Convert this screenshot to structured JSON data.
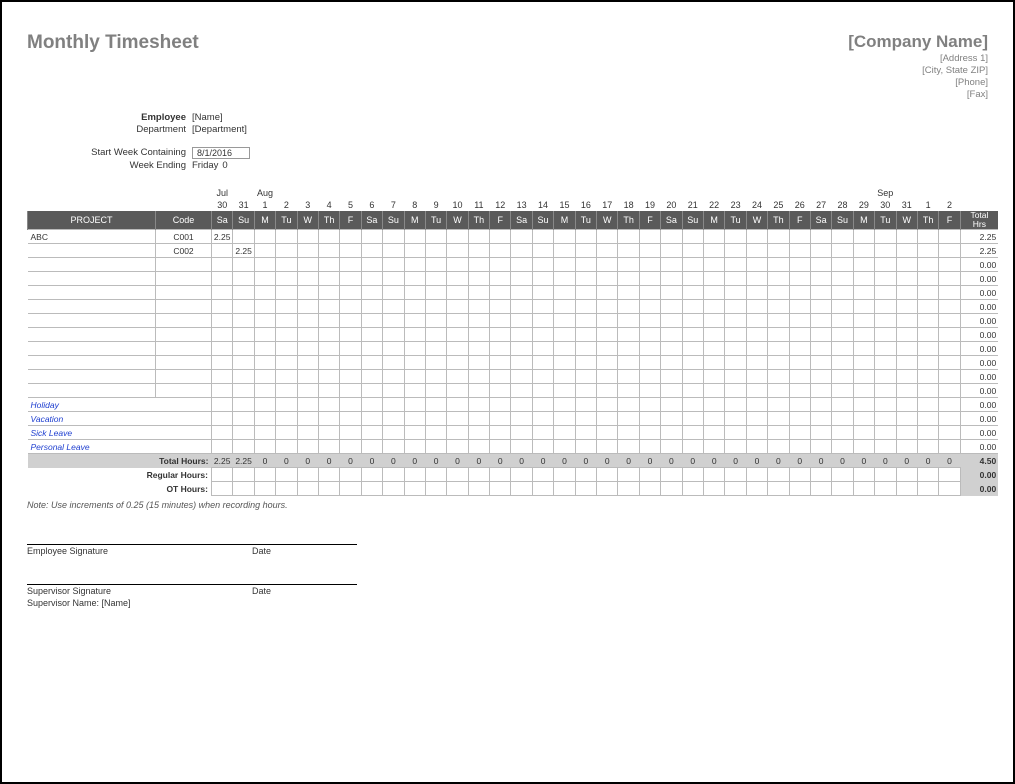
{
  "title": "Monthly Timesheet",
  "company": {
    "name": "[Company Name]",
    "address1": "[Address 1]",
    "cityzip": "[City, State ZIP]",
    "phone": "[Phone]",
    "fax": "[Fax]"
  },
  "info": {
    "employee_label": "Employee",
    "employee_value": "[Name]",
    "department_label": "Department",
    "department_value": "[Department]",
    "startweek_label": "Start Week Containing",
    "startweek_value": "8/1/2016",
    "weekending_label": "Week Ending",
    "weekending_value": "Friday",
    "weekending_after": "0"
  },
  "months": [
    "",
    "",
    "Jul",
    "",
    "Aug",
    "",
    "",
    "",
    "",
    "",
    "",
    "",
    "",
    "",
    "",
    "",
    "",
    "",
    "",
    "",
    "",
    "",
    "",
    "",
    "",
    "",
    "",
    "",
    "",
    "",
    "",
    "",
    "",
    "Sep",
    "",
    ""
  ],
  "dates": [
    "",
    "",
    "30",
    "31",
    "1",
    "2",
    "3",
    "4",
    "5",
    "6",
    "7",
    "8",
    "9",
    "10",
    "11",
    "12",
    "13",
    "14",
    "15",
    "16",
    "17",
    "18",
    "19",
    "20",
    "21",
    "22",
    "23",
    "24",
    "25",
    "26",
    "27",
    "28",
    "29",
    "30",
    "31",
    "1",
    "2",
    ""
  ],
  "dow_header": {
    "project": "PROJECT",
    "code": "Code",
    "total": "Total\nHrs"
  },
  "dow": [
    "Sa",
    "Su",
    "M",
    "Tu",
    "W",
    "Th",
    "F",
    "Sa",
    "Su",
    "M",
    "Tu",
    "W",
    "Th",
    "F",
    "Sa",
    "Su",
    "M",
    "Tu",
    "W",
    "Th",
    "F",
    "Sa",
    "Su",
    "M",
    "Tu",
    "W",
    "Th",
    "F",
    "Sa",
    "Su",
    "M",
    "Tu",
    "W",
    "Th",
    "F"
  ],
  "rows": [
    {
      "project": "ABC",
      "code": "C001",
      "cells": [
        "2.25",
        "",
        "",
        "",
        "",
        "",
        "",
        "",
        "",
        "",
        "",
        "",
        "",
        "",
        "",
        "",
        "",
        "",
        "",
        "",
        "",
        "",
        "",
        "",
        "",
        "",
        "",
        "",
        "",
        "",
        "",
        "",
        "",
        "",
        ""
      ],
      "total": "2.25"
    },
    {
      "project": "",
      "code": "C002",
      "cells": [
        "",
        "2.25",
        "",
        "",
        "",
        "",
        "",
        "",
        "",
        "",
        "",
        "",
        "",
        "",
        "",
        "",
        "",
        "",
        "",
        "",
        "",
        "",
        "",
        "",
        "",
        "",
        "",
        "",
        "",
        "",
        "",
        "",
        "",
        "",
        ""
      ],
      "total": "2.25"
    },
    {
      "project": "",
      "code": "",
      "cells": [
        "",
        "",
        "",
        "",
        "",
        "",
        "",
        "",
        "",
        "",
        "",
        "",
        "",
        "",
        "",
        "",
        "",
        "",
        "",
        "",
        "",
        "",
        "",
        "",
        "",
        "",
        "",
        "",
        "",
        "",
        "",
        "",
        "",
        "",
        ""
      ],
      "total": "0.00"
    },
    {
      "project": "",
      "code": "",
      "cells": [
        "",
        "",
        "",
        "",
        "",
        "",
        "",
        "",
        "",
        "",
        "",
        "",
        "",
        "",
        "",
        "",
        "",
        "",
        "",
        "",
        "",
        "",
        "",
        "",
        "",
        "",
        "",
        "",
        "",
        "",
        "",
        "",
        "",
        "",
        ""
      ],
      "total": "0.00"
    },
    {
      "project": "",
      "code": "",
      "cells": [
        "",
        "",
        "",
        "",
        "",
        "",
        "",
        "",
        "",
        "",
        "",
        "",
        "",
        "",
        "",
        "",
        "",
        "",
        "",
        "",
        "",
        "",
        "",
        "",
        "",
        "",
        "",
        "",
        "",
        "",
        "",
        "",
        "",
        "",
        ""
      ],
      "total": "0.00"
    },
    {
      "project": "",
      "code": "",
      "cells": [
        "",
        "",
        "",
        "",
        "",
        "",
        "",
        "",
        "",
        "",
        "",
        "",
        "",
        "",
        "",
        "",
        "",
        "",
        "",
        "",
        "",
        "",
        "",
        "",
        "",
        "",
        "",
        "",
        "",
        "",
        "",
        "",
        "",
        "",
        ""
      ],
      "total": "0.00"
    },
    {
      "project": "",
      "code": "",
      "cells": [
        "",
        "",
        "",
        "",
        "",
        "",
        "",
        "",
        "",
        "",
        "",
        "",
        "",
        "",
        "",
        "",
        "",
        "",
        "",
        "",
        "",
        "",
        "",
        "",
        "",
        "",
        "",
        "",
        "",
        "",
        "",
        "",
        "",
        "",
        ""
      ],
      "total": "0.00"
    },
    {
      "project": "",
      "code": "",
      "cells": [
        "",
        "",
        "",
        "",
        "",
        "",
        "",
        "",
        "",
        "",
        "",
        "",
        "",
        "",
        "",
        "",
        "",
        "",
        "",
        "",
        "",
        "",
        "",
        "",
        "",
        "",
        "",
        "",
        "",
        "",
        "",
        "",
        "",
        "",
        ""
      ],
      "total": "0.00"
    },
    {
      "project": "",
      "code": "",
      "cells": [
        "",
        "",
        "",
        "",
        "",
        "",
        "",
        "",
        "",
        "",
        "",
        "",
        "",
        "",
        "",
        "",
        "",
        "",
        "",
        "",
        "",
        "",
        "",
        "",
        "",
        "",
        "",
        "",
        "",
        "",
        "",
        "",
        "",
        "",
        ""
      ],
      "total": "0.00"
    },
    {
      "project": "",
      "code": "",
      "cells": [
        "",
        "",
        "",
        "",
        "",
        "",
        "",
        "",
        "",
        "",
        "",
        "",
        "",
        "",
        "",
        "",
        "",
        "",
        "",
        "",
        "",
        "",
        "",
        "",
        "",
        "",
        "",
        "",
        "",
        "",
        "",
        "",
        "",
        "",
        ""
      ],
      "total": "0.00"
    },
    {
      "project": "",
      "code": "",
      "cells": [
        "",
        "",
        "",
        "",
        "",
        "",
        "",
        "",
        "",
        "",
        "",
        "",
        "",
        "",
        "",
        "",
        "",
        "",
        "",
        "",
        "",
        "",
        "",
        "",
        "",
        "",
        "",
        "",
        "",
        "",
        "",
        "",
        "",
        "",
        ""
      ],
      "total": "0.00"
    },
    {
      "project": "",
      "code": "",
      "cells": [
        "",
        "",
        "",
        "",
        "",
        "",
        "",
        "",
        "",
        "",
        "",
        "",
        "",
        "",
        "",
        "",
        "",
        "",
        "",
        "",
        "",
        "",
        "",
        "",
        "",
        "",
        "",
        "",
        "",
        "",
        "",
        "",
        "",
        "",
        ""
      ],
      "total": "0.00"
    }
  ],
  "leave_rows": [
    {
      "label": "Holiday",
      "total": "0.00"
    },
    {
      "label": "Vacation",
      "total": "0.00"
    },
    {
      "label": "Sick Leave",
      "total": "0.00"
    },
    {
      "label": "Personal Leave",
      "total": "0.00"
    }
  ],
  "totals": {
    "total_hours_label": "Total Hours:",
    "total_hours": [
      "2.25",
      "2.25",
      "0",
      "0",
      "0",
      "0",
      "0",
      "0",
      "0",
      "0",
      "0",
      "0",
      "0",
      "0",
      "0",
      "0",
      "0",
      "0",
      "0",
      "0",
      "0",
      "0",
      "0",
      "0",
      "0",
      "0",
      "0",
      "0",
      "0",
      "0",
      "0",
      "0",
      "0",
      "0",
      "0"
    ],
    "total_hours_sum": "4.50",
    "regular_label": "Regular Hours:",
    "regular_sum": "0.00",
    "ot_label": "OT Hours:",
    "ot_sum": "0.00"
  },
  "note": "Note: Use increments of 0.25 (15 minutes) when recording hours.",
  "signatures": {
    "emp_sig": "Employee Signature",
    "date": "Date",
    "sup_sig": "Supervisor Signature",
    "sup_name_label": "Supervisor Name:",
    "sup_name_value": "[Name]"
  }
}
